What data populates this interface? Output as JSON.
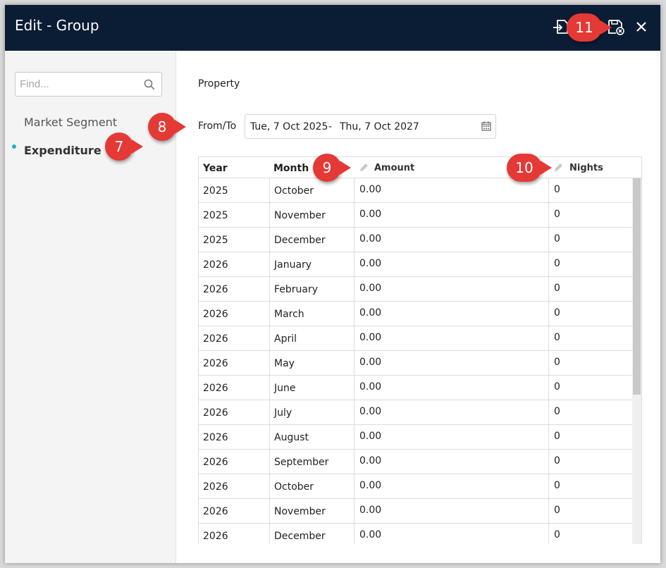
{
  "dialog": {
    "title": "Edit - Group"
  },
  "header_icons": [
    "import-icon",
    "save-close-icon",
    "close-icon"
  ],
  "sidebar": {
    "search_placeholder": "Find...",
    "items": [
      {
        "label": "Market Segment",
        "active": false
      },
      {
        "label": "Expenditure",
        "active": true
      }
    ]
  },
  "main": {
    "property_label": "Property",
    "fromto_label": "From/To",
    "date_from": "Tue, 7 Oct 2025",
    "date_separator": "-",
    "date_to": "Thu, 7 Oct 2027"
  },
  "grid": {
    "columns": [
      "Year",
      "Month",
      "Amount",
      "Nights"
    ],
    "rows": [
      {
        "year": "2025",
        "month": "October",
        "amount": "0.00",
        "nights": "0"
      },
      {
        "year": "2025",
        "month": "November",
        "amount": "0.00",
        "nights": "0"
      },
      {
        "year": "2025",
        "month": "December",
        "amount": "0.00",
        "nights": "0"
      },
      {
        "year": "2026",
        "month": "January",
        "amount": "0.00",
        "nights": "0"
      },
      {
        "year": "2026",
        "month": "February",
        "amount": "0.00",
        "nights": "0"
      },
      {
        "year": "2026",
        "month": "March",
        "amount": "0.00",
        "nights": "0"
      },
      {
        "year": "2026",
        "month": "April",
        "amount": "0.00",
        "nights": "0"
      },
      {
        "year": "2026",
        "month": "May",
        "amount": "0.00",
        "nights": "0"
      },
      {
        "year": "2026",
        "month": "June",
        "amount": "0.00",
        "nights": "0"
      },
      {
        "year": "2026",
        "month": "July",
        "amount": "0.00",
        "nights": "0"
      },
      {
        "year": "2026",
        "month": "August",
        "amount": "0.00",
        "nights": "0"
      },
      {
        "year": "2026",
        "month": "September",
        "amount": "0.00",
        "nights": "0"
      },
      {
        "year": "2026",
        "month": "October",
        "amount": "0.00",
        "nights": "0"
      },
      {
        "year": "2026",
        "month": "November",
        "amount": "0.00",
        "nights": "0"
      },
      {
        "year": "2026",
        "month": "December",
        "amount": "0.00",
        "nights": "0"
      }
    ]
  },
  "callouts": [
    "7",
    "8",
    "9",
    "10",
    "11"
  ],
  "colors": {
    "header_bg": "#0b1d35",
    "accent": "#1ab6c8",
    "callout": "#e53935"
  }
}
